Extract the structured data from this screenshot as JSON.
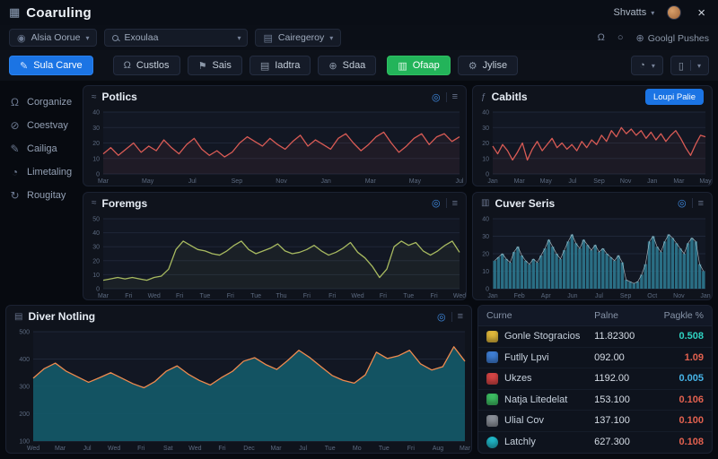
{
  "window": {
    "title": "Coaruling",
    "user": "Shvatts"
  },
  "filterbar": {
    "user_filter": "Alsia Oorue",
    "search": "Exoulaa",
    "category": "Cairegeroy",
    "globe_label": "Goolgl Pushes"
  },
  "toolbar": {
    "primary": "Sula Carve",
    "buttons": [
      "Custlos",
      "Sais",
      "Iadtra",
      "Sdaa",
      "Ofaap",
      "Jylise"
    ]
  },
  "sidebar": {
    "items": [
      {
        "label": "Corganize"
      },
      {
        "label": "Coestvay"
      },
      {
        "label": "Cailiga"
      },
      {
        "label": "Limetaling"
      },
      {
        "label": "Rougitay"
      }
    ]
  },
  "panels": {
    "potlics": {
      "title": "Potlics"
    },
    "cabitls": {
      "title": "Cabitls",
      "action_label": "Loupi Palie"
    },
    "foremgs": {
      "title": "Foremgs"
    },
    "cuver": {
      "title": "Cuver Seris"
    },
    "diver": {
      "title": "Diver Notling"
    }
  },
  "table": {
    "headers": [
      "Curne",
      "Palne",
      "Pagkle %"
    ],
    "rows": [
      {
        "name": "Gonle Stogracios",
        "value": "11.82300",
        "change": "0.508",
        "change_color": "#2fd3c2",
        "icon_color": "#e2b93b",
        "icon_shape": "square"
      },
      {
        "name": "Futlly Lpvi",
        "value": "092.00",
        "change": "1.09",
        "change_color": "#e2614f",
        "icon_color": "#3f7fd6",
        "icon_shape": "square"
      },
      {
        "name": "Ukzes",
        "value": "1192.00",
        "change": "0.005",
        "change_color": "#46b4e8",
        "icon_color": "#d64545",
        "icon_shape": "square"
      },
      {
        "name": "Natja Litedelat",
        "value": "153.100",
        "change": "0.106",
        "change_color": "#e2614f",
        "icon_color": "#3dbd62",
        "icon_shape": "square"
      },
      {
        "name": "Ulial Cov",
        "value": "137.100",
        "change": "0.100",
        "change_color": "#e2614f",
        "icon_color": "#8a8f98",
        "icon_shape": "square"
      },
      {
        "name": "Latchly",
        "value": "627.300",
        "change": "0.108",
        "change_color": "#e2614f",
        "icon_color": "#20b8c9",
        "icon_shape": "circle"
      }
    ]
  },
  "chart_data": [
    {
      "id": "potlics",
      "type": "line",
      "title": "Potlics",
      "color": "#d95b55",
      "fill": "#d95b55",
      "fill_opacity": 0.07,
      "ylim": [
        0,
        40
      ],
      "yticks": [
        0,
        10,
        20,
        30,
        40
      ],
      "xticks": [
        "Mar",
        "May",
        "Jul",
        "Sep",
        "Nov",
        "Jan",
        "Mar",
        "May",
        "Jul"
      ],
      "values": [
        13,
        17,
        12,
        16,
        20,
        14,
        18,
        15,
        22,
        17,
        13,
        19,
        23,
        16,
        12,
        15,
        11,
        14,
        20,
        24,
        21,
        18,
        23,
        19,
        16,
        21,
        25,
        18,
        22,
        19,
        16,
        23,
        26,
        20,
        15,
        19,
        24,
        27,
        20,
        14,
        18,
        23,
        26,
        19,
        24,
        26,
        21,
        24
      ]
    },
    {
      "id": "cabitls",
      "type": "line",
      "title": "Cabitls",
      "color": "#d95b55",
      "fill": "#d95b55",
      "fill_opacity": 0.05,
      "ylim": [
        0,
        40
      ],
      "yticks": [
        0,
        10,
        20,
        30,
        40
      ],
      "xticks": [
        "Jan",
        "Mar",
        "May",
        "Jul",
        "Sep",
        "Nov",
        "Jan",
        "Mar",
        "May"
      ],
      "values": [
        18,
        13,
        19,
        15,
        9,
        14,
        20,
        9,
        16,
        21,
        15,
        19,
        23,
        17,
        20,
        16,
        19,
        15,
        21,
        17,
        22,
        19,
        25,
        21,
        28,
        24,
        30,
        26,
        29,
        25,
        28,
        23,
        27,
        22,
        26,
        21,
        25,
        28,
        23,
        17,
        12,
        19,
        25,
        24
      ]
    },
    {
      "id": "foremgs",
      "type": "line",
      "title": "Foremgs",
      "color": "#a8ba60",
      "fill": "#a8ba60",
      "fill_opacity": 0.06,
      "ylim": [
        0,
        50
      ],
      "yticks": [
        0,
        10,
        20,
        30,
        40,
        50
      ],
      "xticks": [
        "Mar",
        "Fri",
        "Wed",
        "Fri",
        "Tue",
        "Fri",
        "Tue",
        "Thu",
        "Fri",
        "Fri",
        "Wed",
        "Fri",
        "Tue",
        "Fri",
        "Wed"
      ],
      "values": [
        6,
        7,
        8,
        7,
        8,
        7,
        6,
        8,
        9,
        14,
        28,
        34,
        31,
        28,
        27,
        25,
        24,
        27,
        31,
        34,
        28,
        25,
        27,
        29,
        32,
        27,
        25,
        26,
        28,
        31,
        27,
        24,
        26,
        29,
        33,
        26,
        22,
        16,
        8,
        14,
        30,
        34,
        31,
        33,
        27,
        24,
        27,
        31,
        34,
        26
      ]
    },
    {
      "id": "cuver",
      "type": "bar",
      "title": "Cuver Seris",
      "color": "#2e7b92",
      "ylim": [
        0,
        40
      ],
      "yticks": [
        0,
        10,
        20,
        30,
        40
      ],
      "xticks": [
        "Jan",
        "Feb",
        "Apr",
        "Jun",
        "Jul",
        "Sep",
        "Oct",
        "Nov",
        "Jan"
      ],
      "values": [
        16,
        18,
        20,
        17,
        15,
        21,
        24,
        19,
        16,
        14,
        17,
        15,
        19,
        23,
        28,
        24,
        20,
        17,
        22,
        27,
        31,
        26,
        23,
        28,
        25,
        22,
        25,
        21,
        23,
        20,
        18,
        16,
        19,
        15,
        5,
        4,
        3,
        4,
        8,
        14,
        27,
        30,
        24,
        21,
        27,
        31,
        29,
        26,
        23,
        20,
        26,
        29,
        27,
        14,
        10
      ]
    },
    {
      "id": "diver",
      "type": "area",
      "title": "Diver Notling",
      "color": "#ef8a4e",
      "fill": "#145666",
      "fill_opacity": 0.95,
      "ml": 30,
      "ylim": [
        100,
        500
      ],
      "yticks": [
        100,
        200,
        300,
        400,
        500
      ],
      "xticks": [
        "Wed",
        "Mar",
        "Jul",
        "Wed",
        "Fri",
        "Sat",
        "Wed",
        "Fri",
        "Dec",
        "Mar",
        "Jul",
        "Tue",
        "Mo",
        "Tue",
        "Fri",
        "Aug",
        "Mar"
      ],
      "values": [
        330,
        365,
        385,
        355,
        335,
        315,
        332,
        350,
        330,
        310,
        295,
        318,
        355,
        375,
        345,
        322,
        305,
        332,
        355,
        392,
        405,
        380,
        362,
        395,
        432,
        405,
        372,
        340,
        322,
        312,
        342,
        425,
        402,
        412,
        432,
        382,
        360,
        372,
        445,
        392
      ]
    }
  ]
}
